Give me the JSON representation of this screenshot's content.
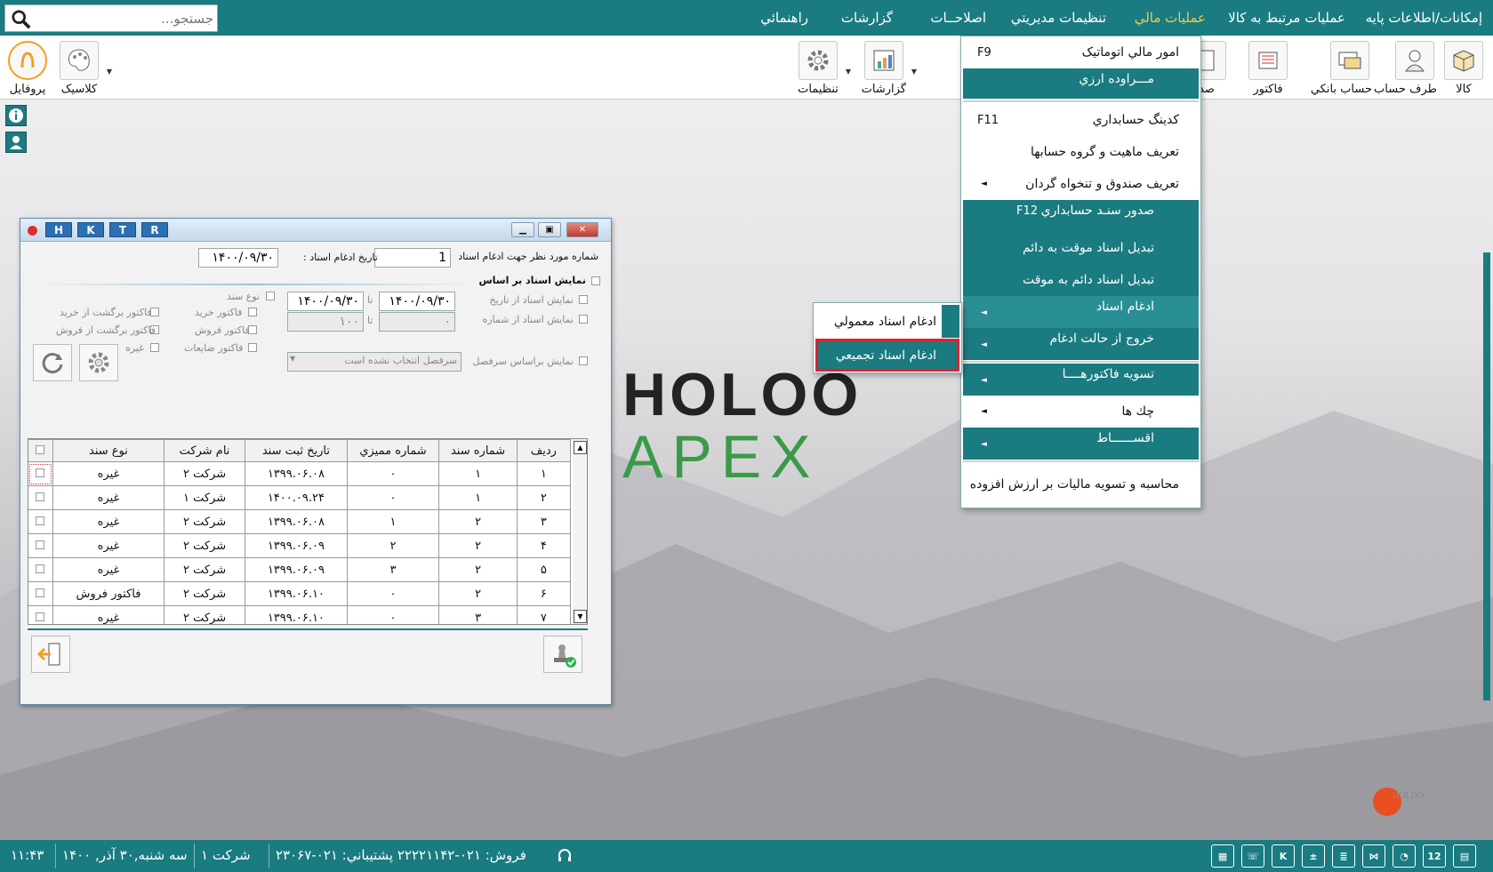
{
  "menubar": {
    "items": [
      "إمكانات/اطلاعات پايه",
      "عمليات مرتبط به كالا",
      "عمليات مالي",
      "تنظيمات مديريتي",
      "اصلاحــات",
      "گزارشات",
      "راهنمائي"
    ],
    "active": "عمليات مالي",
    "search_placeholder": "جستجو..."
  },
  "toolbar": {
    "right_items": [
      "كالا",
      "طرف حساب",
      "حساب بانكي",
      "فاكتور",
      "صد"
    ],
    "reports_label": "گزارشات",
    "settings_label": "تنظيمات",
    "classic_label": "كلاسيک",
    "profile_label": "پروفايل"
  },
  "dropdown": {
    "items": [
      {
        "label": "امور مالي اتوماتيک",
        "key": "F9"
      },
      {
        "label": "مـــراوده ارزي",
        "key": ""
      },
      {
        "label": "كدينگ حسابداري",
        "key": "F11"
      },
      {
        "label": "تعريف ماهيت و گروه حسابها",
        "key": ""
      },
      {
        "label": "تعريف صندوق و تنخواه گردان",
        "key": ""
      },
      {
        "label": "صدور سنـد حسابداري",
        "key": "F12"
      },
      {
        "label": "تبديل اسناد موقت به دائم",
        "key": ""
      },
      {
        "label": "تبديل اسناد دائم به موقت",
        "key": ""
      },
      {
        "label": "ادغام اسناد",
        "key": ""
      },
      {
        "label": "خروج از حالت ادغام",
        "key": ""
      },
      {
        "label": "تسويه فاكتورهــــا",
        "key": ""
      },
      {
        "label": "چك ها",
        "key": ""
      },
      {
        "label": "اقســــــاط",
        "key": ""
      },
      {
        "label": "محاسبه و تسويه ماليات بر ارزش افزوده",
        "key": ""
      }
    ]
  },
  "submenu": {
    "items": [
      "ادغام اسناد معمولي",
      "ادغام اسناد تجميعي"
    ],
    "selected": "ادغام اسناد تجميعي"
  },
  "logo": {
    "line1": "HOLOO",
    "line2": "APEX"
  },
  "corner_logo": {
    "name": "HOLOO",
    "sub": "software"
  },
  "dialog": {
    "tabs": [
      "H",
      "K",
      "T",
      "R"
    ],
    "doc_number_label": "شماره مورد نظر جهت ادغام اسناد",
    "doc_number_value": "1",
    "merge_date_label": "تاريخ ادغام اسناد :",
    "merge_date_value": "۱۴۰۰/۰۹/۳۰",
    "show_docs_by": "نمايش اسناد بر اساس",
    "show_from_date": "نمايش اسناد از تاريخ",
    "date_from": "۱۴۰۰/۰۹/۳۰",
    "to": "تا",
    "date_to": "۱۴۰۰/۰۹/۳۰",
    "show_from_number": "نمايش اسناد از شماره",
    "num_from": "۰",
    "num_to": "۱۰۰",
    "doc_type_label": "نوع سند",
    "types": [
      "فاكتور خريد",
      "فاكتور فروش",
      "فاكتور ضايعات",
      "فاكتور برگشت از خريد",
      "فاكتور برگشت از فروش",
      "غيره"
    ],
    "show_by_heading": "نمايش براساس سرفصل",
    "heading_placeholder": "سرفصل انتخاب نشده است",
    "columns": [
      "رديف",
      "شماره سند",
      "شماره مميزي",
      "تاريخ ثبت سند",
      "نام شركت",
      "نوع سند"
    ],
    "rows": [
      [
        "۱",
        "۱",
        "۰",
        "۱۳۹۹.۰۶.۰۸",
        "شركت ۲",
        "غيره"
      ],
      [
        "۲",
        "۱",
        "۰",
        "۱۴۰۰.۰۹.۲۴",
        "شركت ۱",
        "غيره"
      ],
      [
        "۳",
        "۲",
        "۱",
        "۱۳۹۹.۰۶.۰۸",
        "شركت ۲",
        "غيره"
      ],
      [
        "۴",
        "۲",
        "۲",
        "۱۳۹۹.۰۶.۰۹",
        "شركت ۲",
        "غيره"
      ],
      [
        "۵",
        "۲",
        "۳",
        "۱۳۹۹.۰۶.۰۹",
        "شركت ۲",
        "غيره"
      ],
      [
        "۶",
        "۲",
        "۰",
        "۱۳۹۹.۰۶.۱۰",
        "شركت ۲",
        "فاكتور فروش"
      ],
      [
        "۷",
        "۳",
        "۰",
        "۱۳۹۹.۰۶.۱۰",
        "شركت ۲",
        "غيره"
      ]
    ]
  },
  "statusbar": {
    "time": "۱۱:۴۳",
    "date": "سه شنبه,۳۰ آذر, ۱۴۰۰",
    "company": "شركت ۱",
    "phones": "فروش: ۰۲۱-۲۲۲۲۱۱۴۲ پشتيباني: ۰۲۱-۲۳۰۶۷",
    "icon_letter": "K",
    "calendar_day": "12"
  }
}
